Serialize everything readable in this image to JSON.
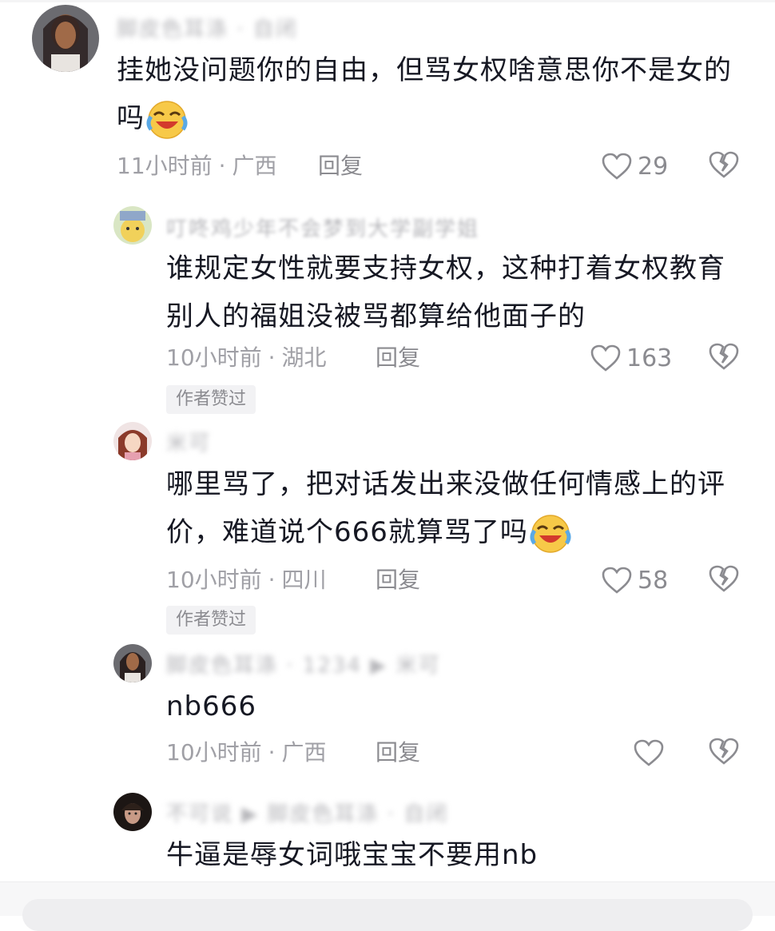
{
  "comments": [
    {
      "username": "脚皮色耳涤 · 自闭",
      "text": "挂她没问题你的自由，但骂女权啥意思你不是女的吗",
      "text_line1": "挂她没问题你的自由，但骂女权啥意思你不是女的",
      "text_line2": "吗",
      "emoji": "cry-laugh-emoji",
      "time": "11小时前",
      "location": "广西",
      "reply_label": "回复",
      "likes": "29"
    },
    {
      "username": "叮咚鸡少年不会梦到大学副学姐",
      "text_line1": "谁规定女性就要支持女权，这种打着女权教育",
      "text_line2": "别人的福姐没被骂都算给他面子的",
      "time": "10小时前",
      "location": "湖北",
      "reply_label": "回复",
      "likes": "163",
      "badge": "作者赞过"
    },
    {
      "username": "米可",
      "text_line1": "哪里骂了，把对话发出来没做任何情感上的评",
      "text_line2": "价，难道说个666就算骂了吗",
      "emoji": "cry-laugh-emoji",
      "time": "10小时前",
      "location": "四川",
      "reply_label": "回复",
      "likes": "58",
      "badge": "作者赞过"
    },
    {
      "username": "脚皮色耳涤 · 1234 ▶ 米可",
      "text_line1": "nb666",
      "time": "10小时前",
      "location": "广西",
      "reply_label": "回复",
      "likes": ""
    },
    {
      "username": "不可说 ▶ 脚皮色耳涤 · 自闭",
      "text_line1": "牛逼是辱女词哦宝宝不要用nb"
    }
  ],
  "meta_separator": "·",
  "colors": {
    "text": "#161823",
    "meta": "#a0a0a6",
    "icon": "#8b8b90",
    "emoji_yellow": "#f7c948",
    "emoji_blue": "#5aa9e6"
  }
}
